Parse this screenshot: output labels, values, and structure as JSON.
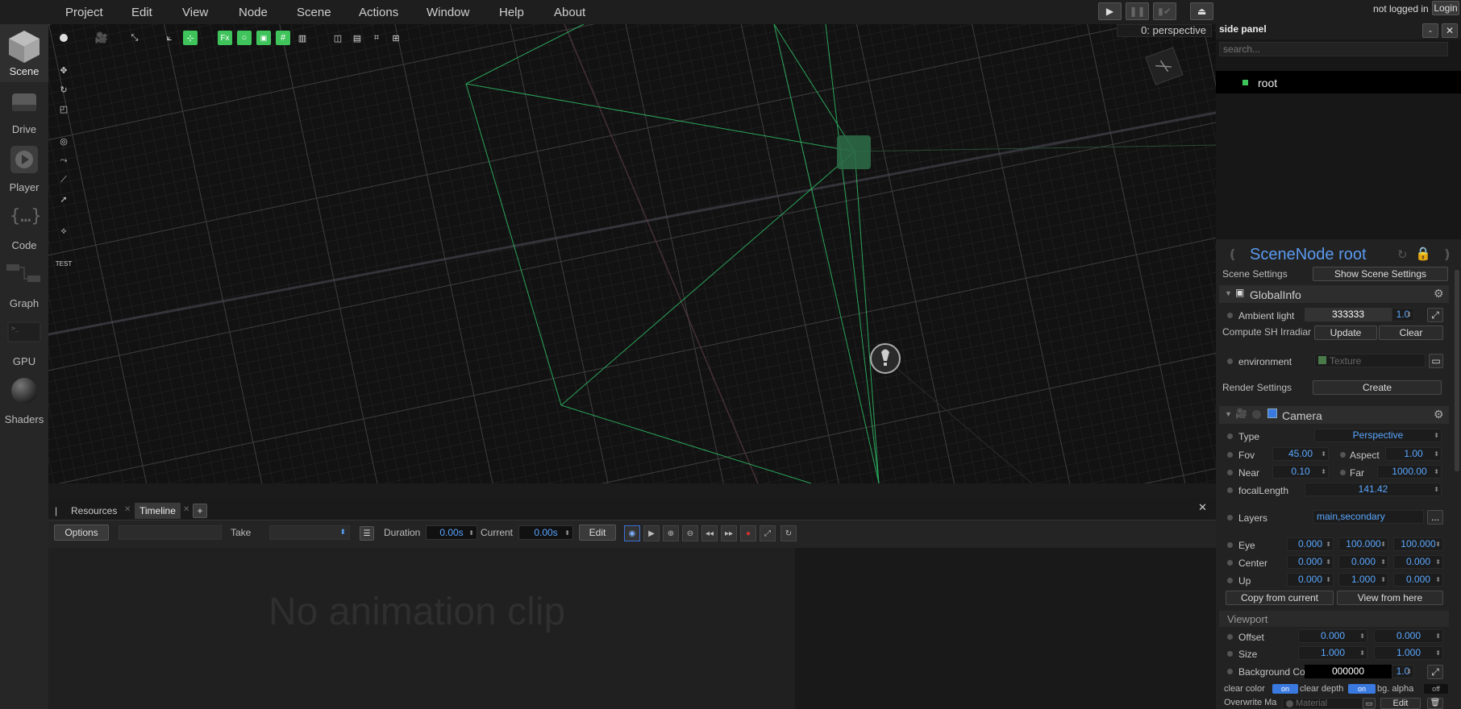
{
  "menu": [
    "Project",
    "Edit",
    "View",
    "Node",
    "Scene",
    "Actions",
    "Window",
    "Help",
    "About"
  ],
  "login": {
    "status": "not logged in",
    "button": "Login"
  },
  "leftbar": [
    {
      "label": "Scene",
      "icon": "cube-icon"
    },
    {
      "label": "Drive",
      "icon": "drive-icon"
    },
    {
      "label": "Player",
      "icon": "play-icon"
    },
    {
      "label": "Code",
      "icon": "code-braces-icon"
    },
    {
      "label": "Graph",
      "icon": "graph-icon"
    },
    {
      "label": "GPU",
      "icon": "gpu-icon"
    },
    {
      "label": "Shaders",
      "icon": "sphere-icon"
    }
  ],
  "viewport": {
    "camera_label": "0: perspective",
    "toolbar_text": "Fx",
    "test_label": "TEST"
  },
  "bottom": {
    "tabs": [
      "Resources",
      "Timeline"
    ],
    "add_tab": "+",
    "options": "Options",
    "take_label": "Take",
    "duration_label": "Duration",
    "duration_value": "0.00s",
    "current_label": "Current",
    "current_value": "0.00s",
    "edit": "Edit",
    "empty_message": "No animation clip"
  },
  "side": {
    "title": "side panel",
    "search_placeholder": "search...",
    "tree_root": "root",
    "node_title": "SceneNode root",
    "scene_settings_label": "Scene Settings",
    "show_scene_settings": "Show Scene Settings",
    "global_info": "GlobalInfo",
    "ambient_label": "Ambient light",
    "ambient_value": "333333",
    "ambient_alpha": "1.0",
    "compute_sh": "Compute SH Irradiar",
    "update": "Update",
    "clear": "Clear",
    "environment_label": "environment",
    "texture_placeholder": "Texture",
    "render_settings": "Render Settings",
    "create": "Create",
    "camera": "Camera",
    "type_label": "Type",
    "type_value": "Perspective",
    "fov_label": "Fov",
    "fov_value": "45.00",
    "aspect_label": "Aspect",
    "aspect_value": "1.00",
    "near_label": "Near",
    "near_value": "0.10",
    "far_label": "Far",
    "far_value": "1000.00",
    "focal_label": "focalLength",
    "focal_value": "141.42",
    "layers_label": "Layers",
    "layers_value": "main,secondary",
    "layers_more": "...",
    "eye_label": "Eye",
    "eye": [
      "0.000",
      "100.000",
      "100.000"
    ],
    "center_label": "Center",
    "center": [
      "0.000",
      "0.000",
      "0.000"
    ],
    "up_label": "Up",
    "up": [
      "0.000",
      "1.000",
      "0.000"
    ],
    "copy_from_current": "Copy from current",
    "view_from_here": "View from here",
    "viewport_heading": "Viewport",
    "offset_label": "Offset",
    "offset": [
      "0.000",
      "0.000"
    ],
    "size_label": "Size",
    "size": [
      "1.000",
      "1.000"
    ],
    "bg_label": "Background Co",
    "bg_value": "000000",
    "bg_alpha": "1.0",
    "clear_color": "clear color",
    "clear_color_toggle": "on",
    "clear_depth": "clear depth",
    "clear_depth_toggle": "on",
    "bg_alpha_label": "bg. alpha",
    "bg_alpha_toggle": "off",
    "overwrite_label": "Overwrite Ma",
    "material_placeholder": "Material",
    "overwrite_edit": "Edit"
  }
}
